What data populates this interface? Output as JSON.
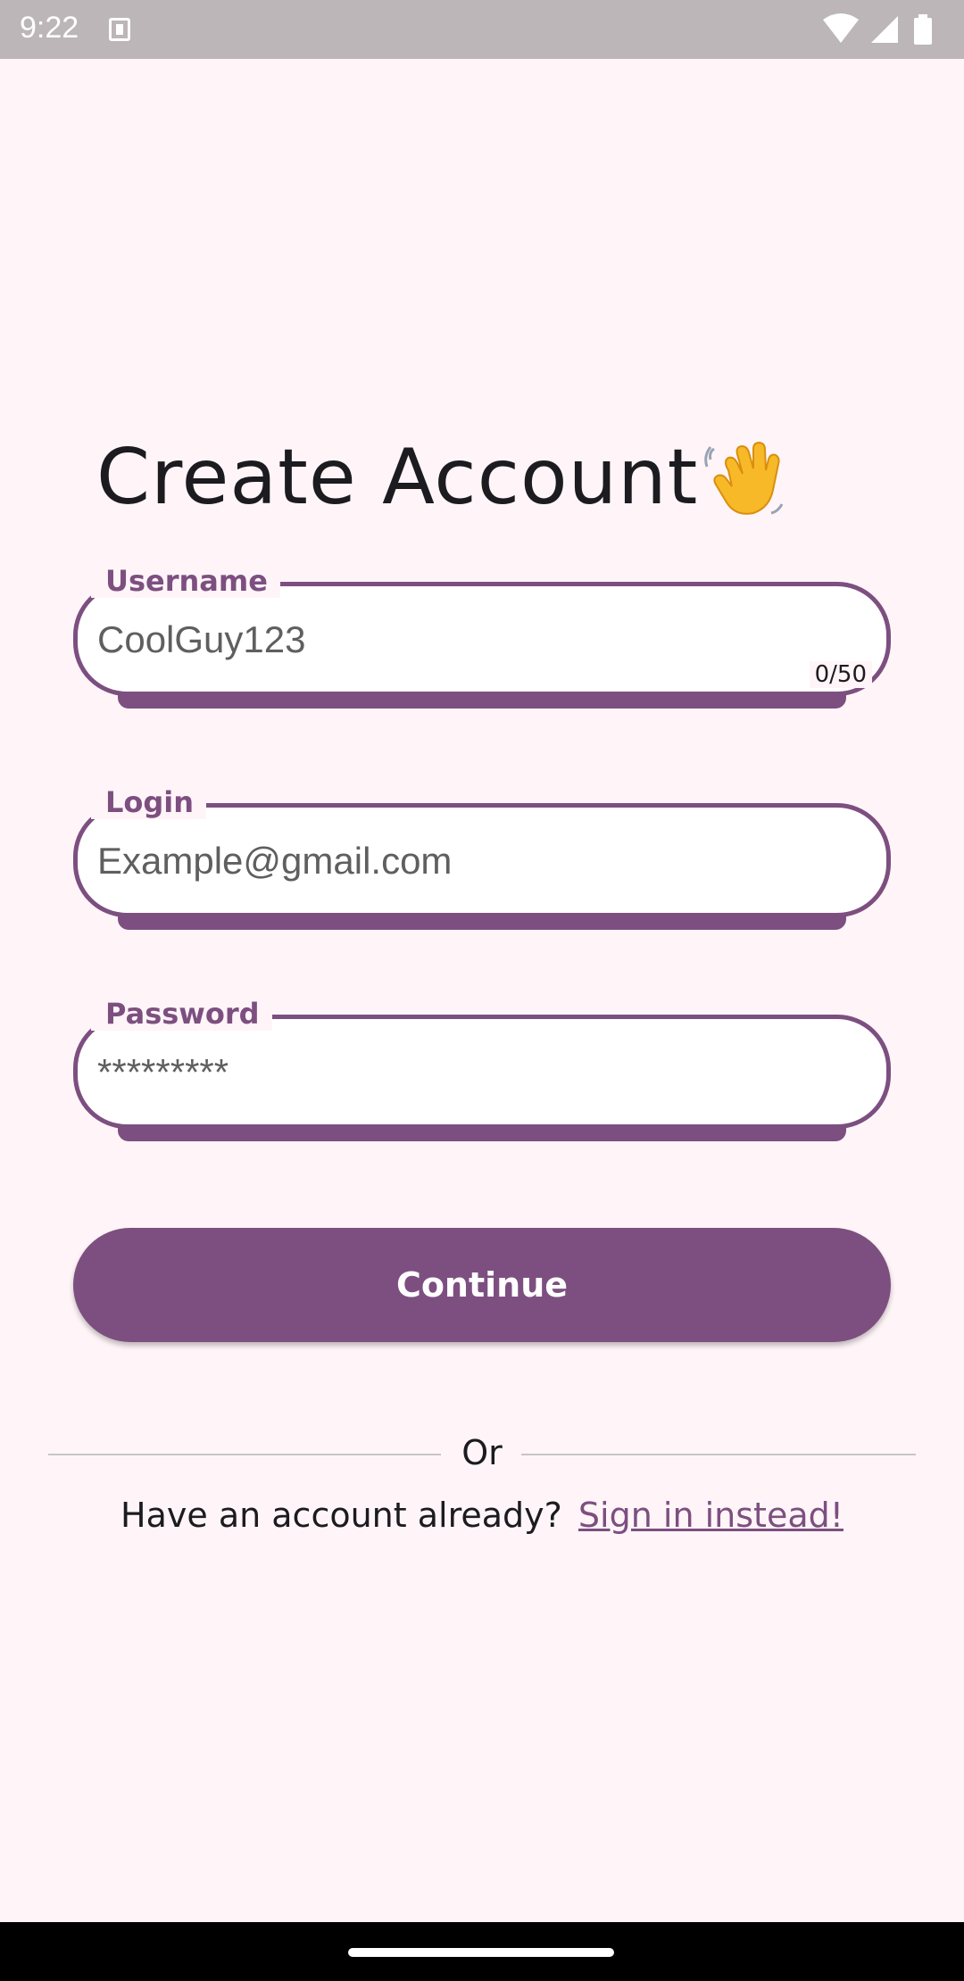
{
  "status_bar": {
    "time": "9:22"
  },
  "screen": {
    "title": "Create Account",
    "title_emoji_icon": "waving-hand-icon"
  },
  "fields": {
    "username": {
      "label": "Username",
      "value": "CoolGuy123",
      "counter": "0/50"
    },
    "login": {
      "label": "Login",
      "value": "Example@gmail.com"
    },
    "password": {
      "label": "Password",
      "value": "*********"
    }
  },
  "actions": {
    "continue_label": "Continue",
    "divider_text": "Or",
    "have_account_text": "Have an account already?",
    "signin_link_text": "Sign in instead!"
  },
  "colors": {
    "accent": "#7d4f80",
    "background": "#fff5f8",
    "status_bar": "#bcb6b8"
  }
}
